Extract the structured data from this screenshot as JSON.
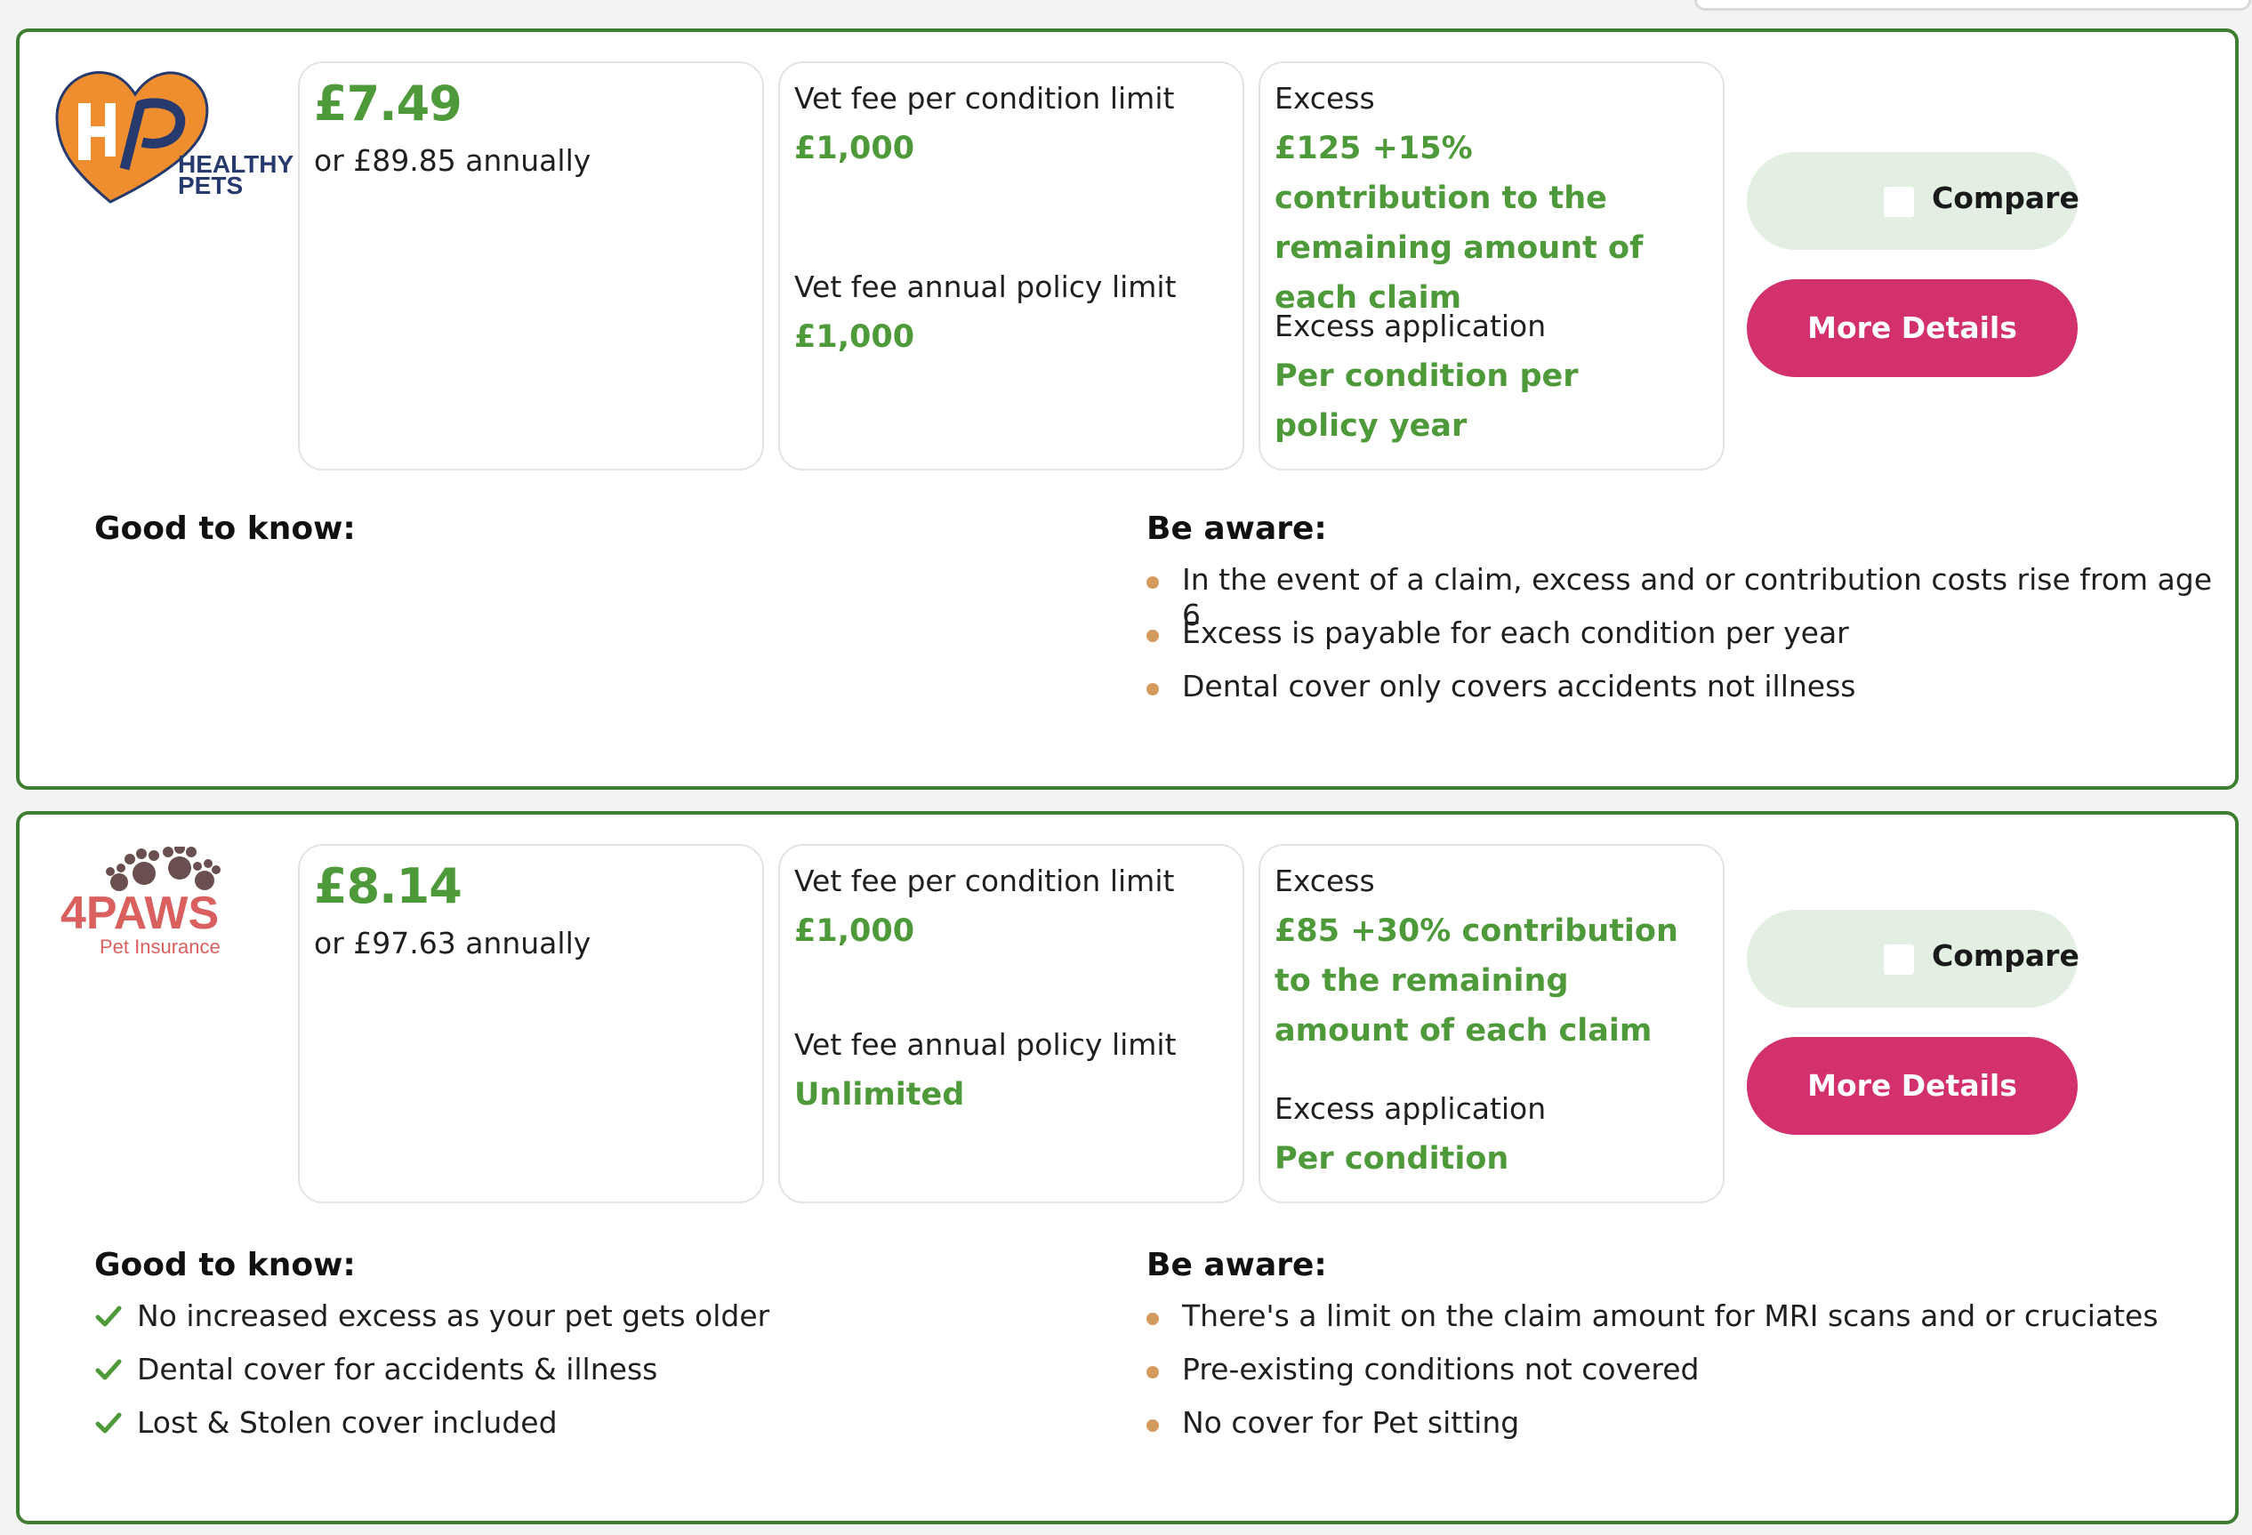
{
  "colors": {
    "accent_green": "#4e9a3a",
    "card_border": "#3f7d32",
    "details_button": "#d3306e",
    "compare_button": "#e3efe3",
    "bullet": "#d49a5e"
  },
  "quotes": [
    {
      "provider": {
        "logo_icon": "healthy-pets-logo",
        "logo_line1": "HEALTHY",
        "logo_line2": "PETS"
      },
      "price": {
        "monthly": "£7.49",
        "annual": "or £89.85 annually"
      },
      "limits": {
        "per_condition_label": "Vet fee per condition limit",
        "per_condition_value": "£1,000",
        "annual_label": "Vet fee annual policy limit",
        "annual_value": "£1,000"
      },
      "excess": {
        "label": "Excess",
        "value": "£125 +15% contribution to the remaining amount of each claim",
        "application_label": "Excess application",
        "application_value": "Per condition per policy year"
      },
      "compare_label": "Compare",
      "compare_checked": false,
      "details_label": "More Details",
      "good_to_know_title": "Good to know:",
      "good_to_know": [],
      "be_aware_title": "Be aware:",
      "be_aware": [
        "In the event of a claim, excess and or contribution costs rise from age 6",
        "Excess is payable for each condition per year",
        "Dental cover only covers accidents not illness"
      ]
    },
    {
      "provider": {
        "logo_icon": "4paws-logo",
        "logo_line1": "4PAWS",
        "logo_line2": "Pet Insurance"
      },
      "price": {
        "monthly": "£8.14",
        "annual": "or £97.63 annually"
      },
      "limits": {
        "per_condition_label": "Vet fee per condition limit",
        "per_condition_value": "£1,000",
        "annual_label": "Vet fee annual policy limit",
        "annual_value": "Unlimited"
      },
      "excess": {
        "label": "Excess",
        "value": "£85 +30% contribution to the remaining amount of each claim",
        "application_label": "Excess application",
        "application_value": "Per condition"
      },
      "compare_label": "Compare",
      "compare_checked": false,
      "details_label": "More Details",
      "good_to_know_title": "Good to know:",
      "good_to_know": [
        "No increased excess as your pet gets older",
        "Dental cover for accidents & illness",
        "Lost & Stolen cover included"
      ],
      "be_aware_title": "Be aware:",
      "be_aware": [
        "There's a limit on the claim amount for MRI scans and or cruciates",
        "Pre-existing conditions not covered",
        "No cover for Pet sitting"
      ]
    }
  ]
}
